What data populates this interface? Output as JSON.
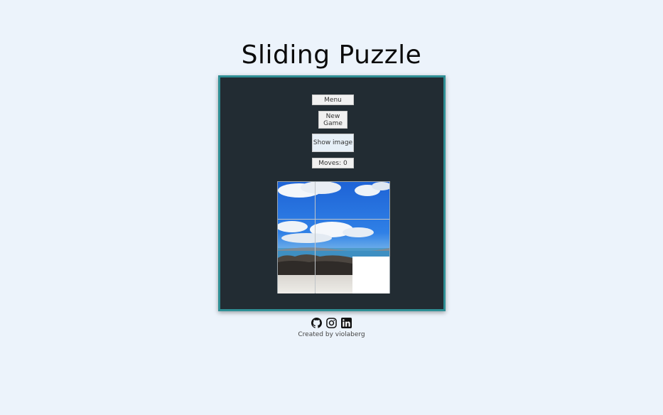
{
  "title": "Sliding Puzzle",
  "controls": {
    "menu_label": "Menu",
    "new_game_label": "New Game",
    "show_image_label": "Show image",
    "moves_text": "Moves: 0"
  },
  "puzzle": {
    "grid_size": 3,
    "tiles": [
      {
        "name": "tile-1",
        "empty": false
      },
      {
        "name": "tile-2",
        "empty": false
      },
      {
        "name": "tile-3",
        "empty": false
      },
      {
        "name": "tile-4",
        "empty": false
      },
      {
        "name": "tile-5",
        "empty": false
      },
      {
        "name": "tile-6",
        "empty": false
      },
      {
        "name": "tile-7",
        "empty": false
      },
      {
        "name": "tile-8",
        "empty": false
      },
      {
        "name": "tile-9",
        "empty": true
      }
    ]
  },
  "footer": {
    "icons": [
      "github-icon",
      "instagram-icon",
      "linkedin-icon"
    ],
    "credit": "Created by violaberg"
  },
  "colors": {
    "page_bg": "#ecf3fb",
    "board_bg": "#222c33",
    "board_border": "#2f8f95"
  }
}
